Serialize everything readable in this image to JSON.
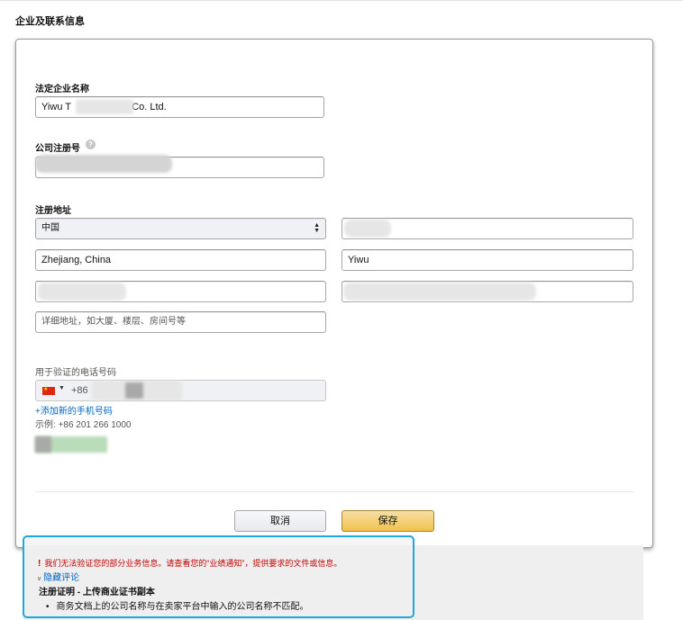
{
  "section": {
    "title": "企业及联系信息"
  },
  "form": {
    "legal_name_label": "法定企业名称",
    "legal_name_value_start": "Yiwu T",
    "legal_name_value_end": "g Co. Ltd.",
    "reg_number_label": "公司注册号",
    "help_icon": "question-mark-icon",
    "address_label": "注册地址",
    "country_value": "中国",
    "province_value": "Zhejiang, China",
    "city_value": "Yiwu",
    "detail_placeholder": "详细地址，如大厦、楼层、房间号等",
    "phone_label": "用于验证的电话号码",
    "phone_flag": "china-flag-icon",
    "phone_dial_code": "+86",
    "add_phone_link": "+添加新的手机号码",
    "phone_example": "示例: +86 201 266 1000",
    "cancel_label": "取消",
    "save_label": "保存"
  },
  "notice": {
    "error_icon": "!",
    "error_text": "我们无法验证您的部分业务信息。请查看您的“业绩通知”，提供要求的文件或信息。",
    "toggle_label": "隐藏评论",
    "heading": "注册证明 - 上传商业证书副本",
    "bullet": "商务文档上的公司名称与在卖家平台中输入的公司名称不匹配。"
  },
  "colors": {
    "link": "#0066c0",
    "error": "#c40000",
    "save_button": "#f0c14b",
    "highlight_border": "#1ea7e1"
  }
}
